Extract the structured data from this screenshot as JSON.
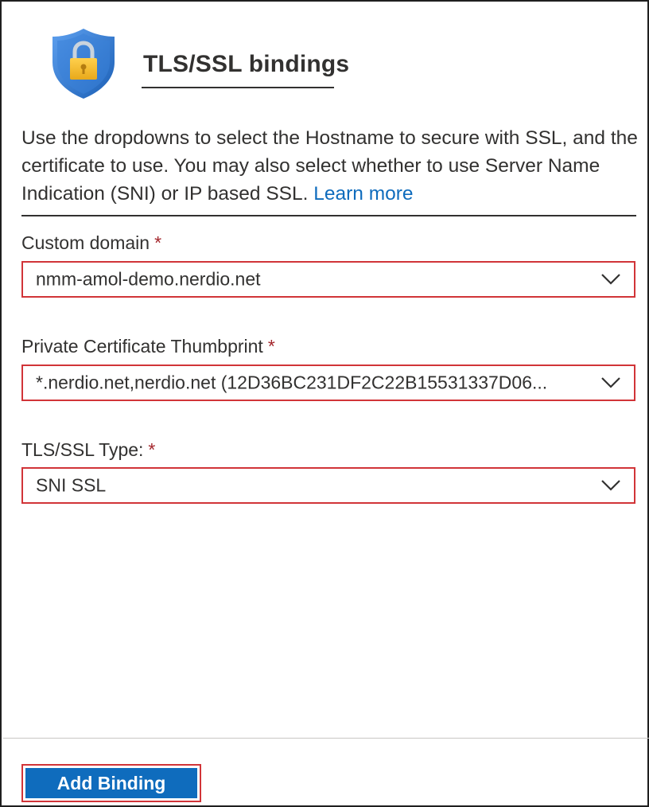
{
  "header": {
    "title": "TLS/SSL bindings",
    "icon": "shield-lock-icon"
  },
  "description": {
    "text": "Use the dropdowns to select the Hostname to secure with SSL, and the certificate to use. You may also select whether to use Server Name Indication (SNI) or IP based SSL. ",
    "link_label": "Learn more"
  },
  "fields": {
    "custom_domain": {
      "label": "Custom domain",
      "required_marker": "*",
      "value": "nmm-amol-demo.nerdio.net"
    },
    "certificate": {
      "label": "Private Certificate Thumbprint",
      "required_marker": "*",
      "value": "*.nerdio.net,nerdio.net (12D36BC231DF2C22B15531337D06..."
    },
    "ssl_type": {
      "label": "TLS/SSL Type:",
      "required_marker": "*",
      "value": "SNI SSL"
    }
  },
  "footer": {
    "add_binding_label": "Add Binding"
  },
  "colors": {
    "accent": "#0f6cbd",
    "highlight_border": "#d13438",
    "required": "#a4262c",
    "text": "#323130"
  }
}
